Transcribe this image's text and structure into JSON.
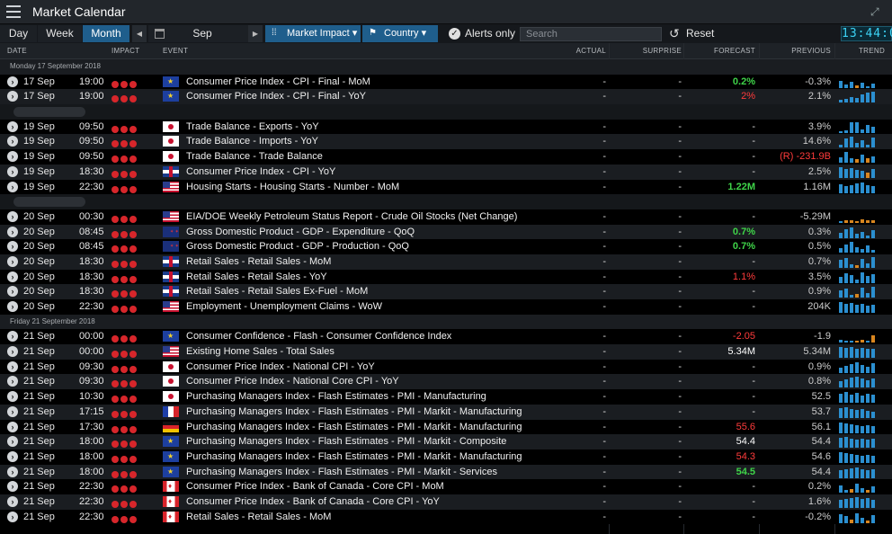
{
  "window": {
    "title": "Market Calendar"
  },
  "toolbar": {
    "day_label": "Day",
    "week_label": "Week",
    "month_label": "Month",
    "period_label": "Sep",
    "market_impact_label": "Market Impact ▾",
    "country_label": "Country ▾",
    "alerts_label": "Alerts only",
    "search_placeholder": "Search",
    "reset_label": "Reset",
    "clock": "13:44:0"
  },
  "columns": {
    "date": "DATE",
    "impact": "IMPACT",
    "event": "EVENT",
    "actual": "ACTUAL",
    "surprise": "SURPRISE",
    "forecast": "FORECAST",
    "previous": "PREVIOUS",
    "trend": "TREND"
  },
  "colors": {
    "accent": "#1f5e8c",
    "impact": "#d7262b",
    "positive": "#3fd449",
    "negative": "#ff3b3b",
    "trend_blue": "#2b8fd0",
    "trend_orange": "#d9861f"
  },
  "rows": [
    {
      "kind": "section",
      "label": "Monday 17 September 2018"
    },
    {
      "kind": "event",
      "date": "17 Sep",
      "time": "19:00",
      "flag": "eu",
      "event": "Consumer Price Index - CPI - Final - MoM",
      "actual": "-",
      "surprise": "-",
      "forecast": "0.2%",
      "forecast_color": "green",
      "previous": "-0.3%",
      "trend": [
        [
          "b",
          8
        ],
        [
          "b",
          4
        ],
        [
          "b",
          7
        ],
        [
          "o",
          3
        ],
        [
          "b",
          6
        ],
        [
          "b",
          2
        ],
        [
          "b",
          5
        ]
      ]
    },
    {
      "kind": "event",
      "date": "17 Sep",
      "time": "19:00",
      "flag": "eu",
      "event": "Consumer Price Index - CPI - Final - YoY",
      "actual": "-",
      "surprise": "-",
      "forecast": "2%",
      "forecast_color": "red",
      "previous": "2.1%",
      "trend": [
        [
          "b",
          3
        ],
        [
          "b",
          4
        ],
        [
          "b",
          6
        ],
        [
          "b",
          5
        ],
        [
          "b",
          9
        ],
        [
          "b",
          11
        ],
        [
          "b",
          12
        ]
      ]
    },
    {
      "kind": "spacer"
    },
    {
      "kind": "event",
      "date": "19 Sep",
      "time": "09:50",
      "flag": "jp",
      "event": "Trade Balance - Exports - YoY",
      "actual": "-",
      "surprise": "-",
      "forecast": "-",
      "forecast_color": "",
      "previous": "3.9%",
      "trend": [
        [
          "b",
          2
        ],
        [
          "b",
          3
        ],
        [
          "b",
          12
        ],
        [
          "b",
          12
        ],
        [
          "b",
          4
        ],
        [
          "b",
          9
        ],
        [
          "b",
          7
        ]
      ]
    },
    {
      "kind": "event",
      "date": "19 Sep",
      "time": "09:50",
      "flag": "jp",
      "event": "Trade Balance - Imports - YoY",
      "actual": "-",
      "surprise": "-",
      "forecast": "-",
      "forecast_color": "",
      "previous": "14.6%",
      "trend": [
        [
          "b",
          3
        ],
        [
          "b",
          10
        ],
        [
          "b",
          12
        ],
        [
          "b",
          5
        ],
        [
          "b",
          8
        ],
        [
          "b",
          3
        ],
        [
          "b",
          11
        ]
      ]
    },
    {
      "kind": "event",
      "date": "19 Sep",
      "time": "09:50",
      "flag": "jp",
      "event": "Trade Balance - Trade Balance",
      "actual": "-",
      "surprise": "-",
      "forecast": "-",
      "forecast_color": "",
      "previous": "(R) -231.9B",
      "previous_color": "red",
      "trend": [
        [
          "b",
          6
        ],
        [
          "b",
          12
        ],
        [
          "b",
          5
        ],
        [
          "o",
          4
        ],
        [
          "b",
          9
        ],
        [
          "o",
          5
        ],
        [
          "b",
          7
        ]
      ]
    },
    {
      "kind": "event",
      "date": "19 Sep",
      "time": "18:30",
      "flag": "gb",
      "event": "Consumer Price Index - CPI - YoY",
      "actual": "-",
      "surprise": "-",
      "forecast": "-",
      "forecast_color": "",
      "previous": "2.5%",
      "trend": [
        [
          "b",
          12
        ],
        [
          "b",
          10
        ],
        [
          "b",
          11
        ],
        [
          "b",
          9
        ],
        [
          "b",
          8
        ],
        [
          "o",
          6
        ],
        [
          "b",
          10
        ]
      ]
    },
    {
      "kind": "event",
      "date": "19 Sep",
      "time": "22:30",
      "flag": "us",
      "event": "Housing Starts - Housing Starts - Number - MoM",
      "actual": "-",
      "surprise": "-",
      "forecast": "1.22M",
      "forecast_color": "green",
      "previous": "1.16M",
      "trend": [
        [
          "b",
          10
        ],
        [
          "b",
          8
        ],
        [
          "b",
          9
        ],
        [
          "b",
          11
        ],
        [
          "b",
          12
        ],
        [
          "b",
          9
        ],
        [
          "b",
          8
        ]
      ]
    },
    {
      "kind": "spacer"
    },
    {
      "kind": "event",
      "date": "20 Sep",
      "time": "00:30",
      "flag": "us",
      "event": "EIA/DOE Weekly Petroleum Status Report - Crude Oil Stocks (Net Change)",
      "actual": "-",
      "surprise": "-",
      "forecast": "-",
      "forecast_color": "",
      "previous": "-5.29M",
      "trend": [
        [
          "b",
          2
        ],
        [
          "o",
          3
        ],
        [
          "o",
          3
        ],
        [
          "o",
          2
        ],
        [
          "o",
          4
        ],
        [
          "o",
          3
        ],
        [
          "o",
          3
        ]
      ]
    },
    {
      "kind": "event",
      "date": "20 Sep",
      "time": "08:45",
      "flag": "nz",
      "event": "Gross Domestic Product - GDP - Expenditure - QoQ",
      "actual": "-",
      "surprise": "-",
      "forecast": "0.7%",
      "forecast_color": "green",
      "previous": "0.3%",
      "trend": [
        [
          "b",
          6
        ],
        [
          "b",
          10
        ],
        [
          "b",
          12
        ],
        [
          "b",
          5
        ],
        [
          "b",
          7
        ],
        [
          "b",
          3
        ],
        [
          "b",
          9
        ]
      ]
    },
    {
      "kind": "event",
      "date": "20 Sep",
      "time": "08:45",
      "flag": "nz",
      "event": "Gross Domestic Product - GDP - Production - QoQ",
      "actual": "-",
      "surprise": "-",
      "forecast": "0.7%",
      "forecast_color": "green",
      "previous": "0.5%",
      "trend": [
        [
          "b",
          5
        ],
        [
          "b",
          9
        ],
        [
          "b",
          12
        ],
        [
          "b",
          6
        ],
        [
          "b",
          4
        ],
        [
          "b",
          8
        ],
        [
          "b",
          3
        ]
      ]
    },
    {
      "kind": "event",
      "date": "20 Sep",
      "time": "18:30",
      "flag": "gb",
      "event": "Retail Sales - Retail Sales - MoM",
      "actual": "-",
      "surprise": "-",
      "forecast": "-",
      "forecast_color": "",
      "previous": "0.7%",
      "trend": [
        [
          "b",
          9
        ],
        [
          "b",
          11
        ],
        [
          "b",
          4
        ],
        [
          "o",
          3
        ],
        [
          "b",
          10
        ],
        [
          "b",
          5
        ],
        [
          "b",
          12
        ]
      ]
    },
    {
      "kind": "event",
      "date": "20 Sep",
      "time": "18:30",
      "flag": "gb",
      "event": "Retail Sales - Retail Sales - YoY",
      "actual": "-",
      "surprise": "-",
      "forecast": "1.1%",
      "forecast_color": "red",
      "previous": "3.5%",
      "trend": [
        [
          "b",
          7
        ],
        [
          "b",
          11
        ],
        [
          "b",
          9
        ],
        [
          "b",
          4
        ],
        [
          "b",
          12
        ],
        [
          "b",
          8
        ],
        [
          "b",
          10
        ]
      ]
    },
    {
      "kind": "event",
      "date": "20 Sep",
      "time": "18:30",
      "flag": "gb",
      "event": "Retail Sales - Retail Sales Ex-Fuel - MoM",
      "actual": "-",
      "surprise": "-",
      "forecast": "-",
      "forecast_color": "",
      "previous": "0.9%",
      "trend": [
        [
          "b",
          8
        ],
        [
          "b",
          10
        ],
        [
          "b",
          3
        ],
        [
          "o",
          4
        ],
        [
          "b",
          11
        ],
        [
          "b",
          5
        ],
        [
          "b",
          12
        ]
      ]
    },
    {
      "kind": "event",
      "date": "20 Sep",
      "time": "22:30",
      "flag": "us",
      "event": "Employment - Unemployment Claims - WoW",
      "actual": "-",
      "surprise": "-",
      "forecast": "-",
      "forecast_color": "",
      "previous": "204K",
      "trend": [
        [
          "b",
          12
        ],
        [
          "b",
          10
        ],
        [
          "b",
          11
        ],
        [
          "b",
          9
        ],
        [
          "b",
          10
        ],
        [
          "b",
          8
        ],
        [
          "b",
          9
        ]
      ]
    },
    {
      "kind": "section",
      "label": "Friday 21 September 2018"
    },
    {
      "kind": "event",
      "date": "21 Sep",
      "time": "00:00",
      "flag": "eu",
      "event": "Consumer Confidence - Flash - Consumer Confidence Index",
      "actual": "-",
      "surprise": "-",
      "forecast": "-2.05",
      "forecast_color": "red",
      "previous": "-1.9",
      "trend": [
        [
          "b",
          3
        ],
        [
          "b",
          2
        ],
        [
          "b",
          2
        ],
        [
          "o",
          2
        ],
        [
          "o",
          3
        ],
        [
          "b",
          2
        ],
        [
          "o",
          8
        ]
      ]
    },
    {
      "kind": "event",
      "date": "21 Sep",
      "time": "00:00",
      "flag": "us",
      "event": "Existing Home Sales - Total Sales",
      "actual": "-",
      "surprise": "-",
      "forecast": "5.34M",
      "forecast_color": "white",
      "previous": "5.34M",
      "trend": [
        [
          "b",
          12
        ],
        [
          "b",
          11
        ],
        [
          "b",
          12
        ],
        [
          "b",
          10
        ],
        [
          "b",
          11
        ],
        [
          "b",
          10
        ],
        [
          "b",
          10
        ]
      ]
    },
    {
      "kind": "event",
      "date": "21 Sep",
      "time": "09:30",
      "flag": "jp",
      "event": "Consumer Price Index - National CPI - YoY",
      "actual": "-",
      "surprise": "-",
      "forecast": "-",
      "forecast_color": "",
      "previous": "0.9%",
      "trend": [
        [
          "b",
          6
        ],
        [
          "b",
          8
        ],
        [
          "b",
          10
        ],
        [
          "b",
          12
        ],
        [
          "b",
          9
        ],
        [
          "b",
          7
        ],
        [
          "b",
          11
        ]
      ]
    },
    {
      "kind": "event",
      "date": "21 Sep",
      "time": "09:30",
      "flag": "jp",
      "event": "Consumer Price Index - National Core CPI - YoY",
      "actual": "-",
      "surprise": "-",
      "forecast": "-",
      "forecast_color": "",
      "previous": "0.8%",
      "trend": [
        [
          "b",
          7
        ],
        [
          "b",
          9
        ],
        [
          "b",
          11
        ],
        [
          "b",
          12
        ],
        [
          "b",
          10
        ],
        [
          "b",
          8
        ],
        [
          "b",
          10
        ]
      ]
    },
    {
      "kind": "event",
      "date": "21 Sep",
      "time": "10:30",
      "flag": "jp",
      "event": "Purchasing Managers Index - Flash Estimates - PMI - Manufacturing",
      "actual": "-",
      "surprise": "-",
      "forecast": "-",
      "forecast_color": "",
      "previous": "52.5",
      "trend": [
        [
          "b",
          10
        ],
        [
          "b",
          12
        ],
        [
          "b",
          9
        ],
        [
          "b",
          11
        ],
        [
          "b",
          8
        ],
        [
          "b",
          10
        ],
        [
          "b",
          9
        ]
      ]
    },
    {
      "kind": "event",
      "date": "21 Sep",
      "time": "17:15",
      "flag": "fr",
      "event": "Purchasing Managers Index - Flash Estimates - PMI - Markit - Manufacturing",
      "actual": "-",
      "surprise": "-",
      "forecast": "-",
      "forecast_color": "",
      "previous": "53.7",
      "trend": [
        [
          "b",
          11
        ],
        [
          "b",
          12
        ],
        [
          "b",
          10
        ],
        [
          "b",
          9
        ],
        [
          "b",
          10
        ],
        [
          "b",
          8
        ],
        [
          "b",
          7
        ]
      ]
    },
    {
      "kind": "event",
      "date": "21 Sep",
      "time": "17:30",
      "flag": "de",
      "event": "Purchasing Managers Index - Flash Estimates - PMI - Markit - Manufacturing",
      "actual": "-",
      "surprise": "-",
      "forecast": "55.6",
      "forecast_color": "red",
      "previous": "56.1",
      "trend": [
        [
          "b",
          12
        ],
        [
          "b",
          11
        ],
        [
          "b",
          10
        ],
        [
          "b",
          9
        ],
        [
          "b",
          8
        ],
        [
          "b",
          9
        ],
        [
          "b",
          8
        ]
      ]
    },
    {
      "kind": "event",
      "date": "21 Sep",
      "time": "18:00",
      "flag": "eu",
      "event": "Purchasing Managers Index - Flash Estimates - PMI - Markit - Composite",
      "actual": "-",
      "surprise": "-",
      "forecast": "54.4",
      "forecast_color": "white",
      "previous": "54.4",
      "trend": [
        [
          "b",
          11
        ],
        [
          "b",
          12
        ],
        [
          "b",
          10
        ],
        [
          "b",
          9
        ],
        [
          "b",
          10
        ],
        [
          "b",
          9
        ],
        [
          "b",
          10
        ]
      ]
    },
    {
      "kind": "event",
      "date": "21 Sep",
      "time": "18:00",
      "flag": "eu",
      "event": "Purchasing Managers Index - Flash Estimates - PMI - Markit - Manufacturing",
      "actual": "-",
      "surprise": "-",
      "forecast": "54.3",
      "forecast_color": "red",
      "previous": "54.6",
      "trend": [
        [
          "b",
          12
        ],
        [
          "b",
          11
        ],
        [
          "b",
          10
        ],
        [
          "b",
          9
        ],
        [
          "b",
          8
        ],
        [
          "b",
          9
        ],
        [
          "b",
          8
        ]
      ]
    },
    {
      "kind": "event",
      "date": "21 Sep",
      "time": "18:00",
      "flag": "eu",
      "event": "Purchasing Managers Index - Flash Estimates - PMI - Markit - Services",
      "actual": "-",
      "surprise": "-",
      "forecast": "54.5",
      "forecast_color": "green",
      "previous": "54.4",
      "trend": [
        [
          "b",
          9
        ],
        [
          "b",
          10
        ],
        [
          "b",
          11
        ],
        [
          "b",
          12
        ],
        [
          "b",
          10
        ],
        [
          "b",
          9
        ],
        [
          "b",
          10
        ]
      ]
    },
    {
      "kind": "event",
      "date": "21 Sep",
      "time": "22:30",
      "flag": "ca",
      "event": "Consumer Price Index - Bank of Canada - Core CPI - MoM",
      "actual": "-",
      "surprise": "-",
      "forecast": "-",
      "forecast_color": "",
      "previous": "0.2%",
      "trend": [
        [
          "b",
          8
        ],
        [
          "b",
          3
        ],
        [
          "o",
          4
        ],
        [
          "b",
          10
        ],
        [
          "b",
          5
        ],
        [
          "o",
          3
        ],
        [
          "b",
          7
        ]
      ]
    },
    {
      "kind": "event",
      "date": "21 Sep",
      "time": "22:30",
      "flag": "ca",
      "event": "Consumer Price Index - Bank of Canada - Core CPI - YoY",
      "actual": "-",
      "surprise": "-",
      "forecast": "-",
      "forecast_color": "",
      "previous": "1.6%",
      "trend": [
        [
          "b",
          9
        ],
        [
          "b",
          10
        ],
        [
          "b",
          11
        ],
        [
          "b",
          12
        ],
        [
          "b",
          10
        ],
        [
          "b",
          11
        ],
        [
          "b",
          9
        ]
      ]
    },
    {
      "kind": "event",
      "date": "21 Sep",
      "time": "22:30",
      "flag": "ca",
      "event": "Retail Sales - Retail Sales - MoM",
      "actual": "-",
      "surprise": "-",
      "forecast": "-",
      "forecast_color": "",
      "previous": "-0.2%",
      "trend": [
        [
          "b",
          10
        ],
        [
          "b",
          8
        ],
        [
          "o",
          4
        ],
        [
          "b",
          11
        ],
        [
          "b",
          6
        ],
        [
          "o",
          3
        ],
        [
          "b",
          9
        ]
      ]
    }
  ]
}
